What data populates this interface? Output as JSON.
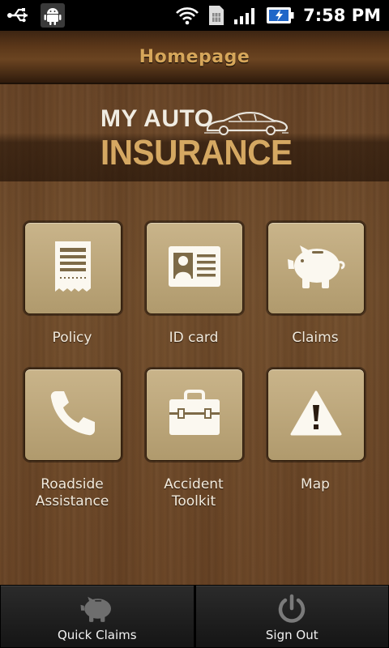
{
  "status_bar": {
    "time": "7:58 PM",
    "icons": [
      "usb-icon",
      "android-debug-icon",
      "wifi-icon",
      "sim-icon",
      "signal-icon",
      "battery-charging-icon"
    ]
  },
  "header": {
    "title": "Homepage"
  },
  "logo": {
    "line1": "MY AUTO",
    "line2": "INSURANCE"
  },
  "tiles": [
    {
      "label": "Policy",
      "icon": "receipt-icon"
    },
    {
      "label": "ID card",
      "icon": "id-card-icon"
    },
    {
      "label": "Claims",
      "icon": "piggy-bank-icon"
    },
    {
      "label": "Roadside\nAssistance",
      "icon": "phone-icon"
    },
    {
      "label": "Accident\nToolkit",
      "icon": "toolbox-icon"
    },
    {
      "label": "Map",
      "icon": "warning-icon"
    }
  ],
  "bottom_bar": {
    "quick_claims": "Quick Claims",
    "sign_out": "Sign Out"
  },
  "colors": {
    "title_text": "#d6a65a",
    "tile_bg": "#c4ae83",
    "logo_gold": "#d5a862"
  }
}
